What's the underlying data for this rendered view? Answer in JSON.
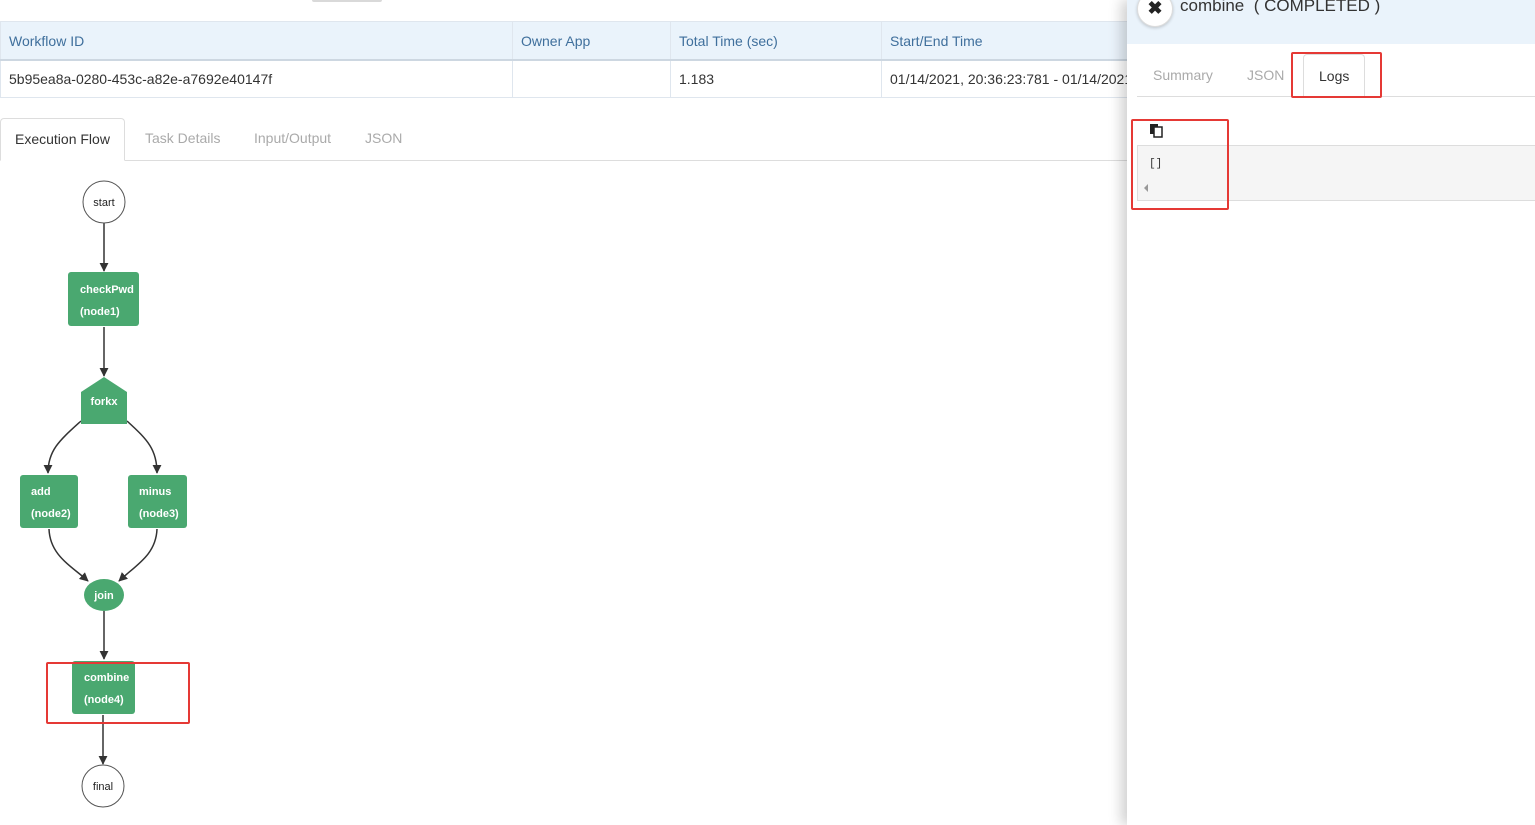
{
  "table": {
    "headers": [
      "Workflow ID",
      "Owner App",
      "Total Time (sec)",
      "Start/End Time"
    ],
    "row": [
      "5b95ea8a-0280-453c-a82e-a7692e40147f",
      "",
      "1.183",
      "01/14/2021, 20:36:23:781 - 01/14/2021"
    ]
  },
  "tabs": [
    "Execution Flow",
    "Task Details",
    "Input/Output",
    "JSON"
  ],
  "graph": {
    "nodes": {
      "start": "start",
      "checkPwd": [
        "checkPwd",
        "(node1)"
      ],
      "forkx": "forkx",
      "add": [
        "add",
        "(node2)"
      ],
      "minus": [
        "minus",
        "(node3)"
      ],
      "join": "join",
      "combine": [
        "combine",
        "(node4)"
      ],
      "final": "final"
    },
    "colors": {
      "task": "#4aa870",
      "border": "#555555",
      "edge": "#333333"
    }
  },
  "panel": {
    "title": "combine  ( COMPLETED )",
    "tabs": [
      "Summary",
      "JSON",
      "Logs"
    ],
    "log_text": "[]"
  },
  "icons": {
    "close": "close-icon",
    "copy": "copy-icon"
  }
}
